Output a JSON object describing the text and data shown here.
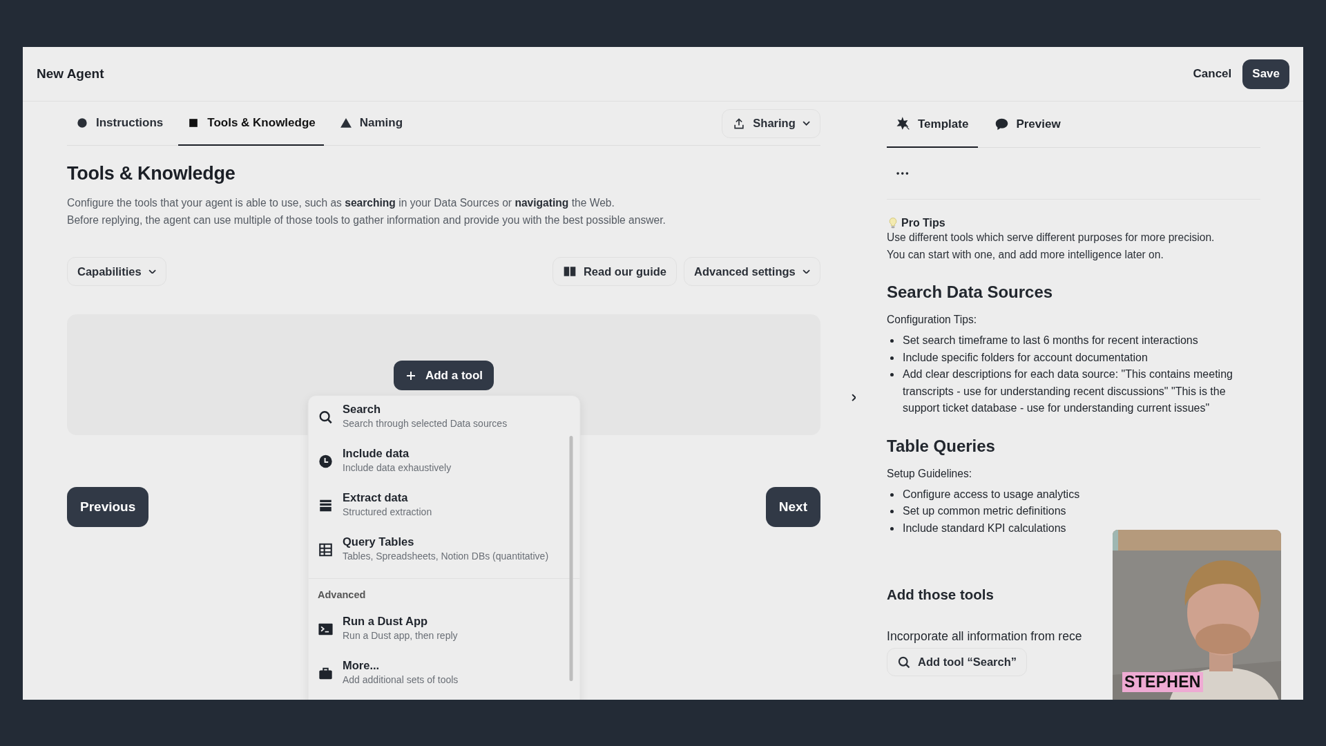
{
  "window": {
    "title": "New Agent"
  },
  "header_actions": [
    {
      "label": "Cancel",
      "kind": "text"
    },
    {
      "label": "Save",
      "kind": "primary"
    }
  ],
  "tabs": [
    {
      "label": "Instructions",
      "selected": false
    },
    {
      "label": "Tools & Knowledge",
      "selected": true
    },
    {
      "label": "Naming",
      "selected": false
    }
  ],
  "sharing": {
    "label": "Sharing"
  },
  "section": {
    "title": "Tools & Knowledge",
    "description": [
      "Configure the tools that your agent is able to use, such as **searching** in your Data Sources or **navigating** the Web.",
      "Before replying, the agent can use multiple of those tools to gather information and provide you with the best possible answer."
    ]
  },
  "toolbar": {
    "capabilities": "Capabilities",
    "guide": "Read our guide",
    "advanced": "Advanced settings"
  },
  "add_tool": {
    "label": "Add a tool"
  },
  "menu": {
    "sections": [
      {
        "items": [
          {
            "title": "Search",
            "subtitle": "Search through selected Data sources"
          },
          {
            "title": "Include data",
            "subtitle": "Include data exhaustively"
          },
          {
            "title": "Extract data",
            "subtitle": "Structured extraction"
          },
          {
            "title": "Query Tables",
            "subtitle": "Tables, Spreadsheets, Notion DBs (quantitative)"
          }
        ]
      },
      {
        "heading": "Advanced",
        "items": [
          {
            "title": "Run a Dust App",
            "subtitle": "Run a Dust app, then reply"
          },
          {
            "title": "More...",
            "subtitle": "Add additional sets of tools"
          }
        ]
      }
    ]
  },
  "navigation": {
    "previous": "Previous",
    "next": "Next"
  },
  "side_tabs": [
    {
      "label": "Template",
      "selected": true
    },
    {
      "label": "Preview",
      "selected": false
    }
  ],
  "pro_tips": {
    "title": "Pro Tips",
    "lines": [
      "Use different tools which serve different purposes for more precision.",
      "You can start with one, and add more intelligence later on."
    ]
  },
  "template_sections": [
    {
      "title": "Search Data Sources",
      "intro": "Configuration Tips:",
      "bullets": [
        "Set search timeframe to last 6 months for recent interactions",
        "Include specific folders for account documentation",
        "Add clear descriptions for each data source: \"This contains meeting transcripts - use for understanding recent discussions\" \"This is the support ticket database - use for understanding current issues\""
      ]
    },
    {
      "title": "Table Queries",
      "intro": "Setup Guidelines:",
      "bullets": [
        "Configure access to usage analytics",
        "Set up common metric definitions",
        "Include standard KPI calculations"
      ]
    }
  ],
  "add_tools": {
    "title": "Add those tools",
    "text": "Incorporate all information from rece",
    "button": "Add tool “Search”"
  },
  "video": {
    "kind": "picture",
    "caption": "STEPHEN"
  }
}
